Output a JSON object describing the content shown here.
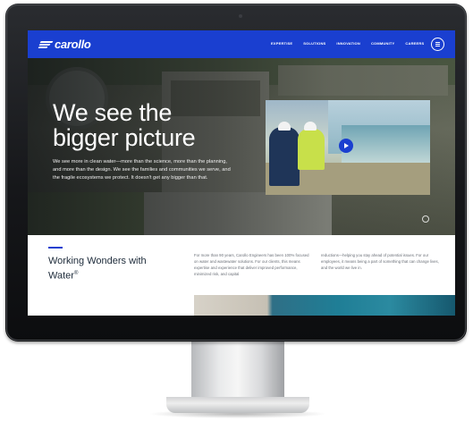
{
  "site": {
    "logo": "carollo",
    "nav": [
      "EXPERTISE",
      "SOLUTIONS",
      "INNOVATION",
      "COMMUNITY",
      "CAREERS"
    ]
  },
  "hero": {
    "title_line1": "We see the",
    "title_line2": "bigger picture",
    "copy": "We see more in clean water—more than the science, more than the planning, and more than the design. We see the families and communities we serve, and the fragile ecosystems we protect. It doesn't get any bigger than that."
  },
  "section": {
    "title": "Working Wonders with Water",
    "trademark": "®",
    "col1": "For more than 90 years, Carollo Engineers has been 100% focused on water and wastewater solutions. For our clients, this means expertise and experience that deliver improved performance, minimized risk, and capital",
    "col2": "reductions—helping you stay ahead of potential issues. For our employees, it means being a part of something that can change lives, and the world we live in."
  },
  "colors": {
    "brand_blue": "#1a3fd0",
    "heading": "#1d2b3a",
    "body_text": "#6b7078"
  },
  "icons": [
    "carollo-logo-icon",
    "menu-icon",
    "play-icon",
    "scroll-indicator-icon"
  ]
}
